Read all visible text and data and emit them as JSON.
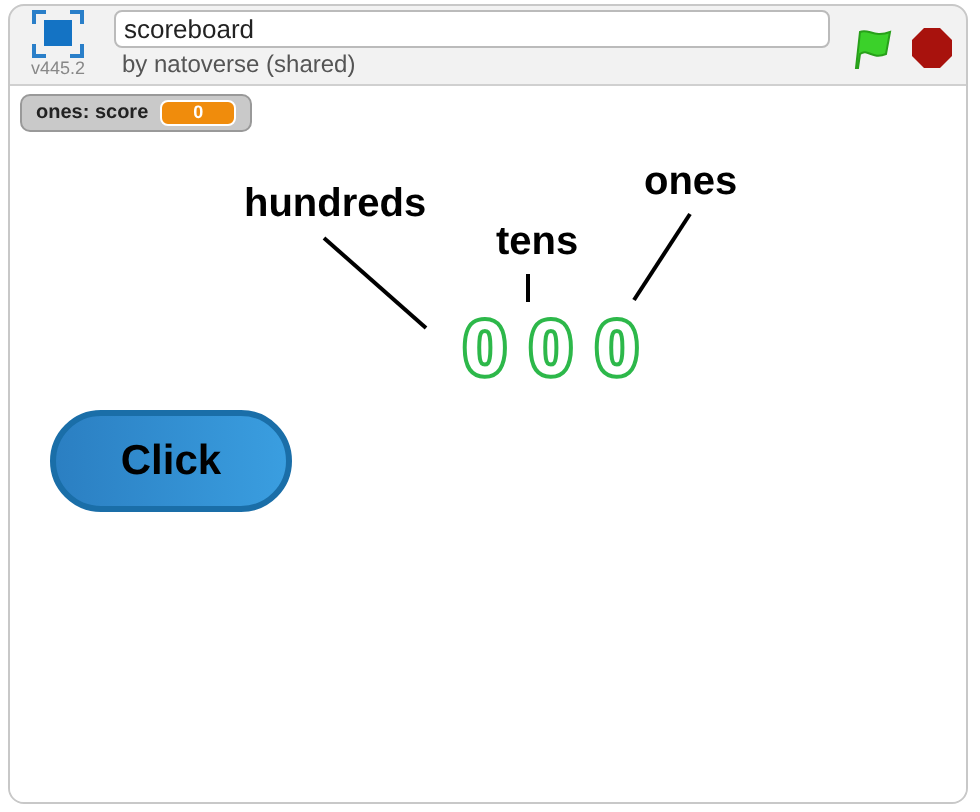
{
  "project": {
    "title": "scoreboard",
    "author": "by natoverse (shared)",
    "version": "v445.2"
  },
  "monitor": {
    "label": "ones: score",
    "value": "0"
  },
  "labels": [
    {
      "text": "hundreds"
    },
    {
      "text": "tens"
    },
    {
      "text": "ones"
    }
  ],
  "digits": [
    "0",
    "0",
    "0"
  ],
  "button": {
    "label": "Click"
  }
}
